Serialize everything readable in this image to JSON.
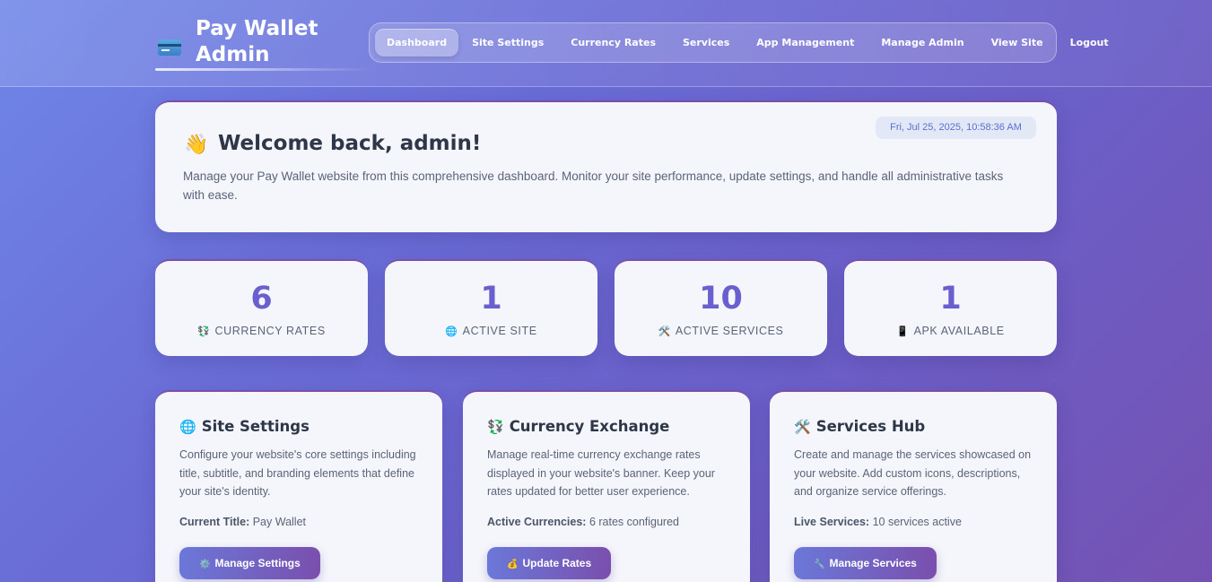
{
  "brand": {
    "title": "Pay Wallet Admin",
    "icon": "credit-card-icon"
  },
  "nav": {
    "items": [
      {
        "label": "Dashboard",
        "active": true
      },
      {
        "label": "Site Settings"
      },
      {
        "label": "Currency Rates"
      },
      {
        "label": "Services"
      },
      {
        "label": "App Management"
      },
      {
        "label": "Manage Admin"
      },
      {
        "label": "View Site"
      },
      {
        "label": "Logout"
      }
    ]
  },
  "welcome": {
    "icon": "👋",
    "heading": "Welcome back, admin!",
    "description": "Manage your Pay Wallet website from this comprehensive dashboard. Monitor your site performance, update settings, and handle all administrative tasks with ease.",
    "datetime": "Fri, Jul 25, 2025, 10:58:36 AM"
  },
  "stats": [
    {
      "value": "6",
      "icon": "💱",
      "label": "CURRENCY RATES"
    },
    {
      "value": "1",
      "icon": "🌐",
      "label": "ACTIVE SITE"
    },
    {
      "value": "10",
      "icon": "🛠️",
      "label": "ACTIVE SERVICES"
    },
    {
      "value": "1",
      "icon": "📱",
      "label": "APK AVAILABLE"
    }
  ],
  "features": [
    {
      "icon": "🌐",
      "title": "Site Settings",
      "description": "Configure your website's core settings including title, subtitle, and branding elements that define your site's identity.",
      "meta_label": "Current Title:",
      "meta_value": " Pay Wallet",
      "button_icon": "⚙️",
      "button_label": "Manage Settings"
    },
    {
      "icon": "💱",
      "title": "Currency Exchange",
      "description": "Manage real-time currency exchange rates displayed in your website's banner. Keep your rates updated for better user experience.",
      "meta_label": "Active Currencies:",
      "meta_value": " 6 rates configured",
      "button_icon": "💰",
      "button_label": "Update Rates"
    },
    {
      "icon": "🛠️",
      "title": "Services Hub",
      "description": "Create and manage the services showcased on your website. Add custom icons, descriptions, and organize service offerings.",
      "meta_label": "Live Services:",
      "meta_value": " 10 services active",
      "button_icon": "🔧",
      "button_label": "Manage Services"
    }
  ]
}
